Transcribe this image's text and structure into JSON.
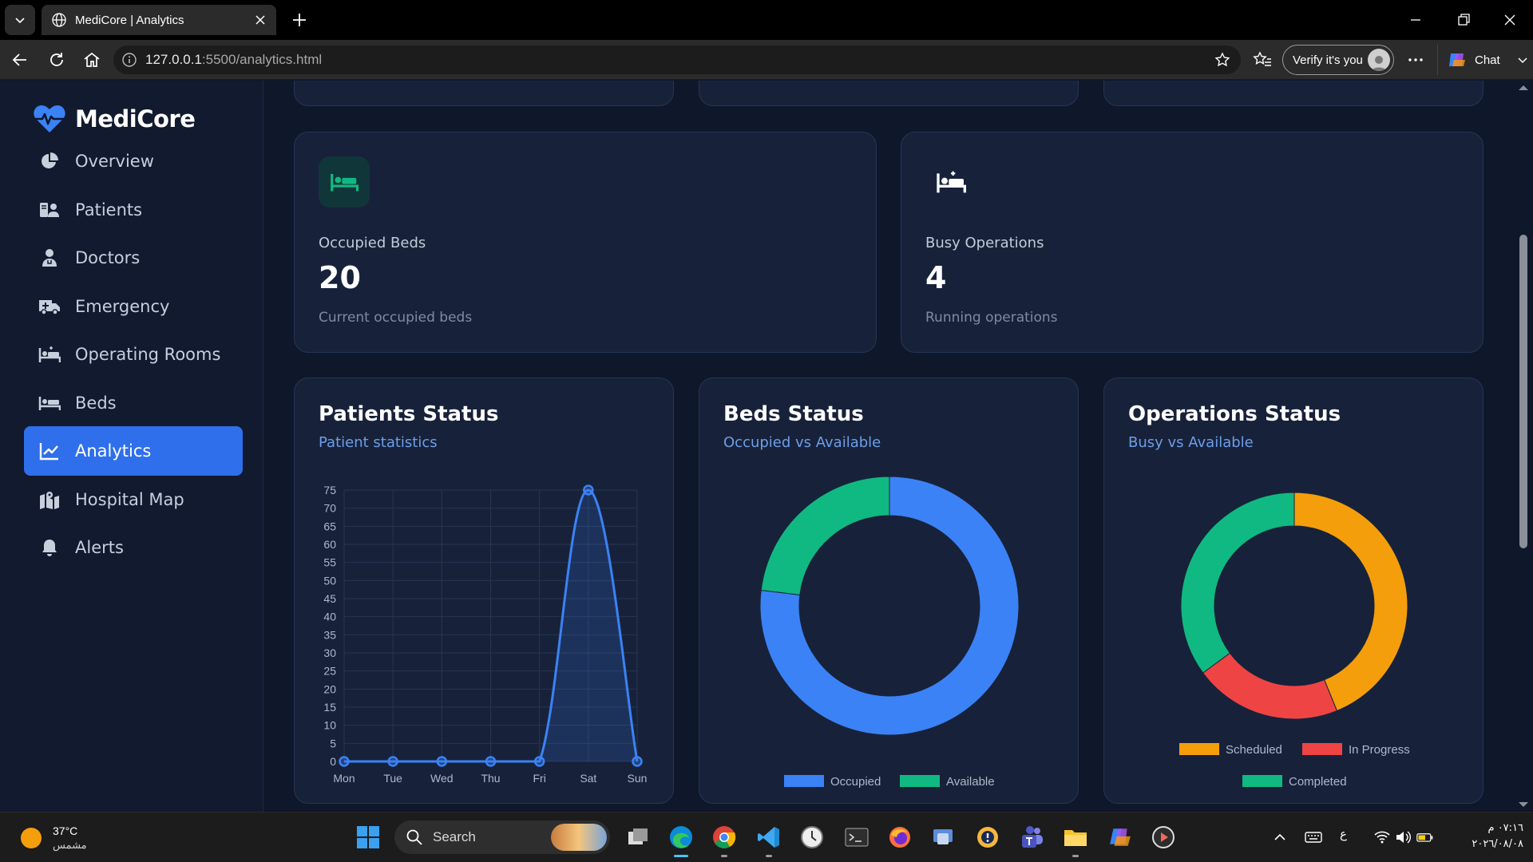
{
  "browser": {
    "tab_title": "MediCore | Analytics",
    "url_host": "127.0.0.1",
    "url_rest": ":5500/analytics.html",
    "verify_label": "Verify it's you",
    "chat_label": "Chat"
  },
  "sidebar": {
    "brand": "MediCore",
    "items": [
      {
        "label": "Overview",
        "icon": "pie-chart-icon"
      },
      {
        "label": "Patients",
        "icon": "patients-icon"
      },
      {
        "label": "Doctors",
        "icon": "doctor-icon"
      },
      {
        "label": "Emergency",
        "icon": "ambulance-icon"
      },
      {
        "label": "Operating Rooms",
        "icon": "procedure-bed-icon"
      },
      {
        "label": "Beds",
        "icon": "bed-icon"
      },
      {
        "label": "Analytics",
        "icon": "line-chart-icon",
        "active": true
      },
      {
        "label": "Hospital Map",
        "icon": "map-icon"
      },
      {
        "label": "Alerts",
        "icon": "bell-icon"
      }
    ]
  },
  "stats": [
    {
      "label": "Occupied Beds",
      "value": "20",
      "sub": "Current occupied beds",
      "icon": "bed-icon",
      "icon_color": "#10b981"
    },
    {
      "label": "Busy Operations",
      "value": "4",
      "sub": "Running operations",
      "icon": "procedure-bed-icon",
      "icon_color": "#ffffff"
    }
  ],
  "charts": {
    "patients": {
      "title": "Patients Status",
      "subtitle": "Patient statistics"
    },
    "beds": {
      "title": "Beds Status",
      "subtitle": "Occupied vs Available"
    },
    "operations": {
      "title": "Operations Status",
      "subtitle": "Busy vs Available"
    }
  },
  "chart_data": [
    {
      "type": "line",
      "title": "Patients Status",
      "categories": [
        "Mon",
        "Tue",
        "Wed",
        "Thu",
        "Fri",
        "Sat",
        "Sun"
      ],
      "series": [
        {
          "values": [
            0,
            0,
            0,
            0,
            0,
            75,
            0
          ]
        }
      ],
      "ylim": [
        0,
        75
      ],
      "yticks": [
        0,
        5,
        10,
        15,
        20,
        25,
        30,
        35,
        40,
        45,
        50,
        55,
        60,
        65,
        70,
        75
      ],
      "grid": true,
      "color": "#3b82f6"
    },
    {
      "type": "pie",
      "title": "Beds Status",
      "labels": [
        "Occupied",
        "Available"
      ],
      "values": [
        20,
        6
      ],
      "colors": [
        "#3b82f6",
        "#10b981"
      ],
      "legend": "bottom"
    },
    {
      "type": "pie",
      "title": "Operations Status",
      "labels": [
        "Scheduled",
        "In Progress",
        "Completed"
      ],
      "values": [
        5,
        2.4,
        4
      ],
      "colors": [
        "#f59e0b",
        "#ef4444",
        "#10b981"
      ],
      "legend": "bottom"
    }
  ],
  "taskbar": {
    "temp": "37°C",
    "condition": "مشمس",
    "search_label": "Search",
    "time": "٠٧:١٦ م",
    "date": "٢٠٢٦/٠٨/٠٨",
    "lang": "ع"
  }
}
